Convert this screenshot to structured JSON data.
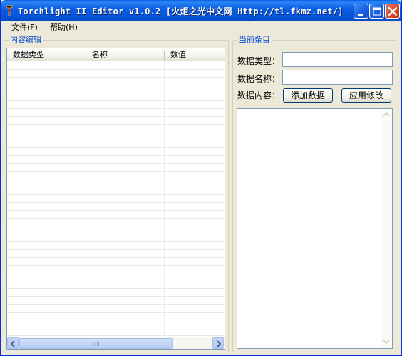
{
  "window": {
    "title": "Torchlight II Editor v1.0.2 [火炬之光中文网 Http://tl.fkmz.net/]",
    "minimize_icon": "minimize-icon",
    "maximize_icon": "maximize-icon",
    "close_icon": "close-icon",
    "colors": {
      "title_bar": "#0a5fe3",
      "close_button": "#d44a2a",
      "group_label": "#0046d5"
    }
  },
  "menu": {
    "file": "文件(F)",
    "help": "帮助(H)"
  },
  "left_panel": {
    "group_label": "内容编辑",
    "columns": [
      "数据类型",
      "名称",
      "数值"
    ],
    "rows": []
  },
  "right_panel": {
    "group_label": "当前条目",
    "data_type_label": "数据类型：",
    "data_type_value": "",
    "data_name_label": "数据名称：",
    "data_name_value": "",
    "data_content_label": "数据内容：",
    "add_button": "添加数据",
    "apply_button": "应用修改",
    "content_value": ""
  }
}
